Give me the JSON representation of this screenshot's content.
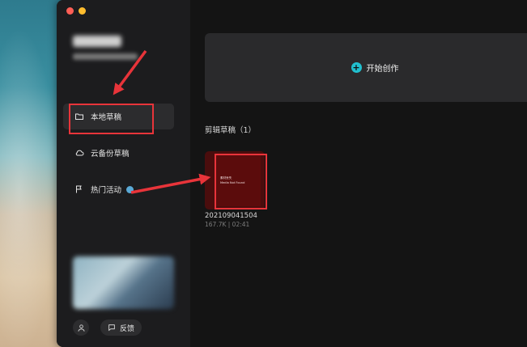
{
  "window": {
    "traffic_lights": [
      "close",
      "minimize"
    ]
  },
  "sidebar": {
    "user": {
      "name_blurred": true
    },
    "items": [
      {
        "label": "本地草稿",
        "icon": "folder-icon",
        "active": true
      },
      {
        "label": "云备份草稿",
        "icon": "cloud-icon",
        "active": false
      },
      {
        "label": "热门活动",
        "icon": "flag-icon",
        "active": false
      }
    ],
    "feedback_label": "反馈"
  },
  "main": {
    "create_label": "开始创作",
    "section_title": "剪辑草稿（1）",
    "drafts": [
      {
        "thumb_line1": "素材丢失",
        "thumb_line2": "Media Not Found",
        "name": "202109041504",
        "meta": "167.7K | 02:41"
      }
    ]
  },
  "colors": {
    "accent": "#21c0cf",
    "annotation": "#e8343a",
    "thumbnail": "#5b0c0c"
  }
}
